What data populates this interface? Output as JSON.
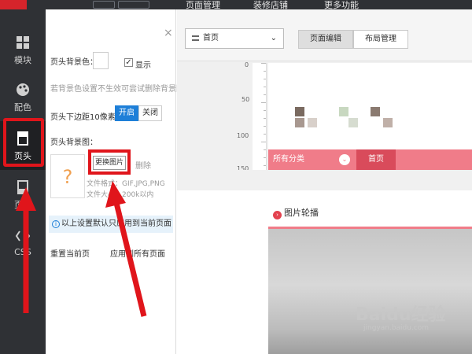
{
  "header": {
    "nav": [
      "页面管理",
      "装修店铺",
      "更多功能"
    ]
  },
  "sidebar": {
    "items": [
      {
        "label": "模块",
        "icon": "grid-icon"
      },
      {
        "label": "配色",
        "icon": "palette-icon"
      },
      {
        "label": "页头",
        "icon": "header-icon",
        "active": true
      },
      {
        "label": "页尾",
        "icon": "footer-icon"
      },
      {
        "label": "CSS",
        "icon": "css-icon"
      }
    ]
  },
  "panel": {
    "header_bg_label": "页头背景色：",
    "show_label": "显示",
    "bg_hint": "若背景色设置不生效可尝试删除背景图",
    "margin_label": "页头下边距10像素：",
    "open_label": "开启",
    "close_btn_label": "关闭",
    "bg_image_label": "页头背景图：",
    "change_image_label": "更换图片",
    "delete_label": "删除",
    "file_format": "文件格式：GIF,JPG,PNG",
    "file_size": "文件大小：200k以内",
    "notice": "以上设置默认只应用到当前页面",
    "reset_label": "重置当前页",
    "apply_all_label": "应用到所有页面",
    "close_icon_glyph": "×"
  },
  "editor": {
    "page_select": "首页",
    "tabs": [
      "页面编辑",
      "布局管理"
    ],
    "ruler_labels": [
      "0",
      "50",
      "100",
      "150"
    ],
    "menu": {
      "category": "所有分类",
      "home": "首页"
    },
    "section_title": "图片轮播"
  },
  "colors": {
    "accent_blue": "#1e7fd8",
    "menu_pink": "#f07c89",
    "menu_dark_pink": "#d94b5b",
    "highlight_red": "#e0151b",
    "sidebar_dark": "#2f3135"
  },
  "watermark": {
    "text": "Baidu经验",
    "url": "jingyan.baidu.com"
  }
}
